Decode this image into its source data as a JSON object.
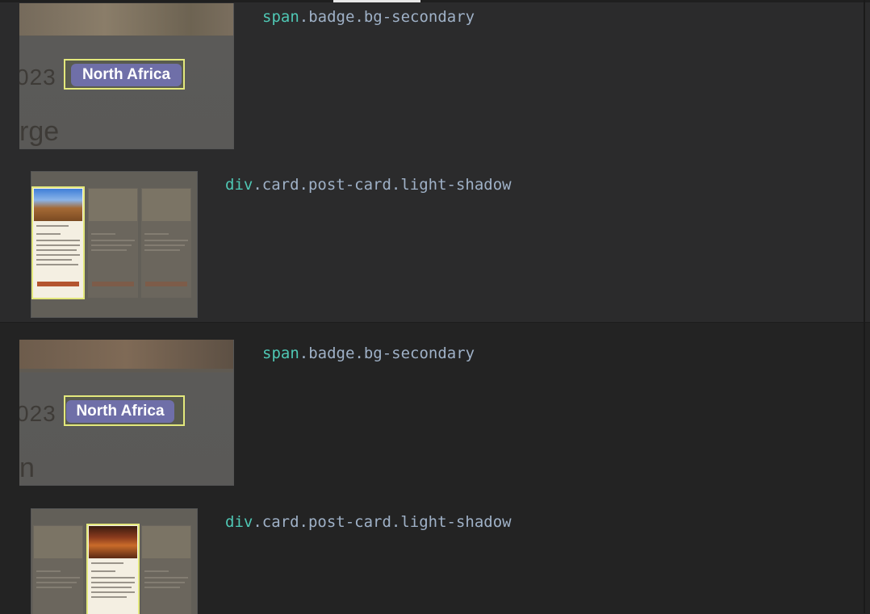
{
  "rows": [
    {
      "badge_element": "span.badge.bg-secondary",
      "badge_text": "North Africa",
      "badge_zoom_year": "023",
      "badge_zoom_word": "rge",
      "card_element": "div.card.post-card.light-shadow"
    },
    {
      "badge_element": "span.badge.bg-secondary",
      "badge_text": "North Africa",
      "badge_zoom_year": "023 (",
      "badge_zoom_word": "n",
      "card_element": "div.card.post-card.light-shadow"
    }
  ],
  "colors": {
    "highlight": "#e3e87c",
    "badge": "#6f6fa8",
    "selector_tag": "#4fc7b4",
    "selector_class": "#9fb1c7"
  }
}
